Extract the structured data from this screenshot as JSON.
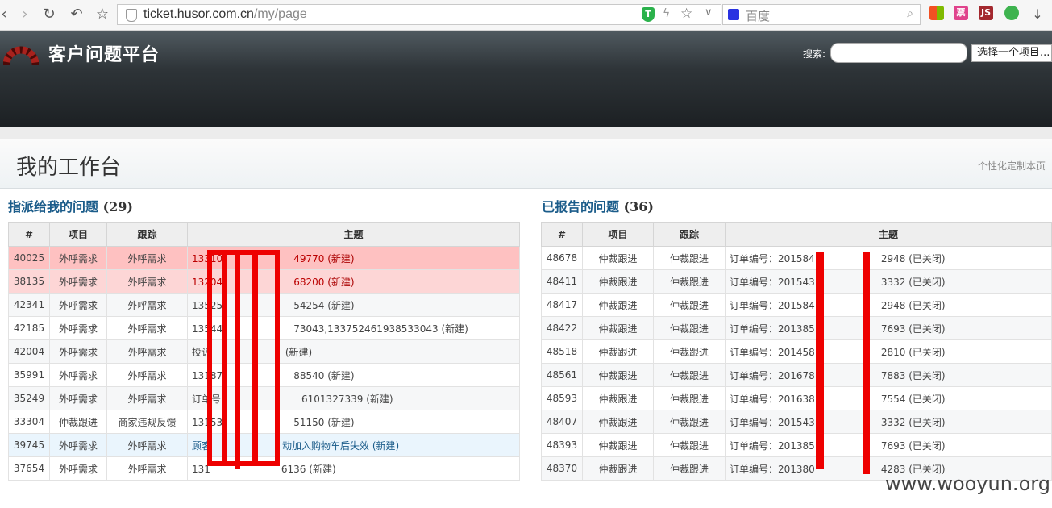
{
  "browser": {
    "url_host": "ticket.husor.com.cn",
    "url_path": "/my/page",
    "search_engine": "百度",
    "ext_ticket": "票",
    "ext_js": "JS"
  },
  "header": {
    "site_title": "客户问题平台",
    "search_label": "搜索:",
    "project_select": "选择一个项目..."
  },
  "page": {
    "title": "我的工作台",
    "customize": "个性化定制本页"
  },
  "assigned": {
    "title": "指派给我的问题",
    "count": "(29)",
    "columns": [
      "#",
      "项目",
      "跟踪",
      "主题"
    ],
    "rows": [
      {
        "id": "40025",
        "project": "外呼需求",
        "tracker": "外呼需求",
        "subject": "13310",
        "status": "(新建)"
      },
      {
        "id": "38135",
        "project": "外呼需求",
        "tracker": "外呼需求",
        "subject": "13204",
        "status": "(新建)"
      },
      {
        "id": "42341",
        "project": "外呼需求",
        "tracker": "外呼需求",
        "subject": "13525",
        "status": "(新建)"
      },
      {
        "id": "42185",
        "project": "外呼需求",
        "tracker": "外呼需求",
        "subject": "13544",
        "status": "(新建)"
      },
      {
        "id": "42004",
        "project": "外呼需求",
        "tracker": "外呼需求",
        "subject": "投诉",
        "status": "(新建)"
      },
      {
        "id": "35991",
        "project": "外呼需求",
        "tracker": "外呼需求",
        "subject": "13187",
        "status": "(新建)"
      },
      {
        "id": "35249",
        "project": "外呼需求",
        "tracker": "外呼需求",
        "subject": "订单号：",
        "status": "(新建)"
      },
      {
        "id": "33304",
        "project": "仲裁跟进",
        "tracker": "商家违规反馈",
        "subject": "13153",
        "status": "(新建)"
      },
      {
        "id": "39745",
        "project": "外呼需求",
        "tracker": "外呼需求",
        "subject": "顾客",
        "status": "(新建)"
      },
      {
        "id": "37654",
        "project": "外呼需求",
        "tracker": "外呼需求",
        "subject": "131",
        "status": "(新建)"
      }
    ],
    "subject_tails": [
      "49770",
      "68200",
      "54254",
      "73043,133752461938533043",
      "",
      "88540",
      "6101327339",
      "51150",
      "动加入购物车后失效",
      "6136"
    ]
  },
  "reported": {
    "title": "已报告的问题",
    "count": "(36)",
    "columns": [
      "#",
      "项目",
      "跟踪",
      "主题"
    ],
    "rows": [
      {
        "id": "48678",
        "project": "仲裁跟进",
        "tracker": "仲裁跟进",
        "subject": "订单编号：201584",
        "tail": "2948",
        "status": "(已关闭)"
      },
      {
        "id": "48411",
        "project": "仲裁跟进",
        "tracker": "仲裁跟进",
        "subject": "订单编号：201543",
        "tail": "3332",
        "status": "(已关闭)"
      },
      {
        "id": "48417",
        "project": "仲裁跟进",
        "tracker": "仲裁跟进",
        "subject": "订单编号：201584",
        "tail": "2948",
        "status": "(已关闭)"
      },
      {
        "id": "48422",
        "project": "仲裁跟进",
        "tracker": "仲裁跟进",
        "subject": "订单编号：201385",
        "tail": "7693",
        "status": "(已关闭)"
      },
      {
        "id": "48518",
        "project": "仲裁跟进",
        "tracker": "仲裁跟进",
        "subject": "订单编号：201458",
        "tail": "2810",
        "status": "(已关闭)"
      },
      {
        "id": "48561",
        "project": "仲裁跟进",
        "tracker": "仲裁跟进",
        "subject": "订单编号：201678",
        "tail": "7883",
        "status": "(已关闭)"
      },
      {
        "id": "48593",
        "project": "仲裁跟进",
        "tracker": "仲裁跟进",
        "subject": "订单编号：201638",
        "tail": "7554",
        "status": "(已关闭)"
      },
      {
        "id": "48407",
        "project": "仲裁跟进",
        "tracker": "仲裁跟进",
        "subject": "订单编号：201543",
        "tail": "3332",
        "status": "(已关闭)"
      },
      {
        "id": "48393",
        "project": "仲裁跟进",
        "tracker": "仲裁跟进",
        "subject": "订单编号：201385",
        "tail": "7693",
        "status": "(已关闭)"
      },
      {
        "id": "48370",
        "project": "仲裁跟进",
        "tracker": "仲裁跟进",
        "subject": "订单编号：201380",
        "tail": "4283",
        "status": "(已关闭)"
      }
    ]
  },
  "watermark": "www.wooyun.org",
  "colors": {
    "redaction": "#ee0000",
    "header_dark": "#1c2023",
    "link": "#1b5c8a"
  }
}
